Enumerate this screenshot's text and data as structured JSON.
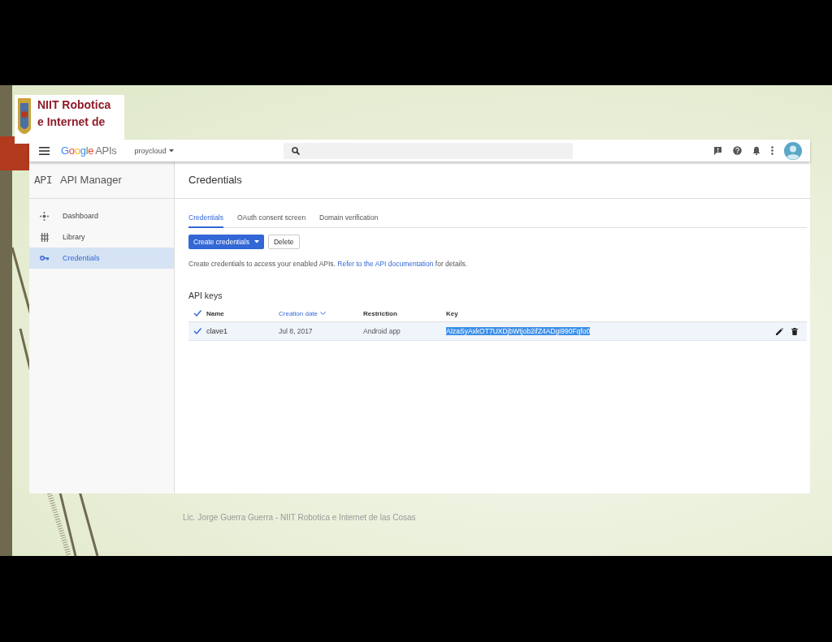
{
  "slide": {
    "logo_lines": [
      "NIIT Robotica",
      "e Internet de"
    ],
    "footer": "Lic. Jorge Guerra Guerra - NIIT Robotica e Internet de las Cosas"
  },
  "topbar": {
    "brand": "Google",
    "brand_suffix": "APIs",
    "project": "proycloud"
  },
  "sidebar": {
    "glyph": "API",
    "title": "API Manager",
    "items": [
      {
        "label": "Dashboard",
        "kind": "dashboard",
        "selected": false
      },
      {
        "label": "Library",
        "kind": "library",
        "selected": false
      },
      {
        "label": "Credentials",
        "kind": "key",
        "selected": true
      }
    ]
  },
  "page": {
    "title": "Credentials",
    "tabs": [
      {
        "label": "Credentials",
        "selected": true
      },
      {
        "label": "OAuth consent screen",
        "selected": false
      },
      {
        "label": "Domain verification",
        "selected": false
      }
    ],
    "buttons": [
      {
        "label": "Create credentials",
        "kind": "primary"
      },
      {
        "label": "Delete",
        "kind": "plain"
      }
    ],
    "info": {
      "before": "Create credentials to access your enabled APIs.",
      "link": "Refer to the API documentation",
      "after": "for details."
    },
    "api_keys": {
      "title": "API keys",
      "all_checked": true,
      "columns": [
        {
          "label": "Name",
          "sorted": false
        },
        {
          "label": "Creation date",
          "sorted": true
        },
        {
          "label": "Restriction",
          "sorted": false
        },
        {
          "label": "Key",
          "sorted": false
        }
      ],
      "rows": [
        {
          "name": "clave1",
          "date": "Jul 8, 2017",
          "restriction": "Android app",
          "key": "AIzaSyAxkOT7UXDjbWtjob2ifZ4ADgi990Fqfo0",
          "checked": true,
          "key_selected": true
        }
      ]
    }
  }
}
